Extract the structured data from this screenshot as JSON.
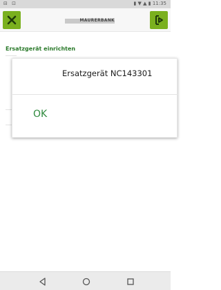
{
  "status_bar": {
    "left_icons": "⊟ ⊡",
    "right_text": "▮ ▼ ▲ ▮ 11:35"
  },
  "app_bar": {
    "logo_text": "MAURERBANK",
    "close_icon": "close-icon",
    "logout_icon": "logout-icon",
    "brand_color": "#7ab01e"
  },
  "screen": {
    "section_title": "Ersatzgerät einrichten"
  },
  "dialog": {
    "message": "Ersatzgerät NC143301",
    "ok_label": "OK"
  },
  "nav_bar": {
    "back_icon": "triangle-back-icon",
    "home_icon": "circle-home-icon",
    "recent_icon": "square-recents-icon"
  }
}
